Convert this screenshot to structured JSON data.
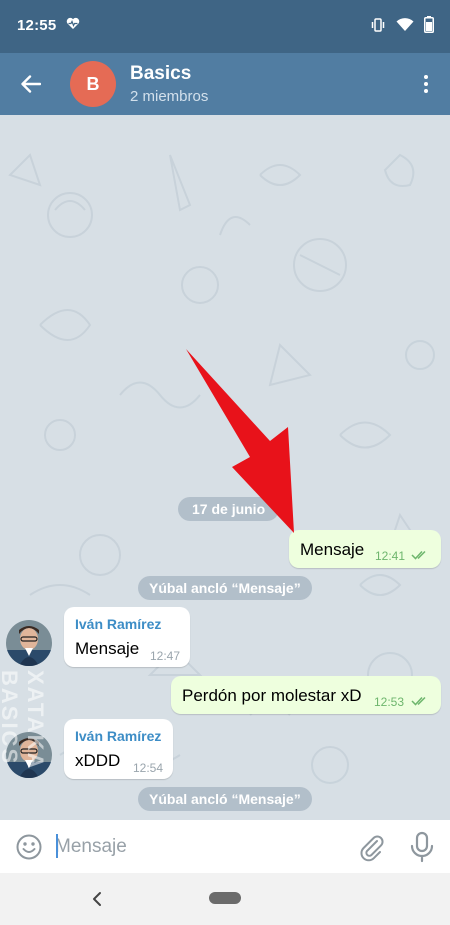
{
  "status_bar": {
    "time": "12:55",
    "left_icon": "heart-pulse-icon",
    "right_icons": [
      "vibrate-icon",
      "wifi-icon",
      "battery-icon"
    ]
  },
  "header": {
    "avatar_letter": "B",
    "avatar_color": "#e56b55",
    "title": "Basics",
    "subtitle": "2 miembros",
    "background": "#517da2"
  },
  "chat": {
    "date_separator": "17 de junio",
    "items": [
      {
        "type": "outgoing",
        "text": "Mensaje",
        "time": "12:41",
        "read": true
      },
      {
        "type": "service",
        "text": "Yúbal ancló “Mensaje”"
      },
      {
        "type": "incoming",
        "sender": "Iván Ramírez",
        "text": "Mensaje",
        "time": "12:47"
      },
      {
        "type": "outgoing",
        "text": "Perdón por molestar xD",
        "time": "12:53",
        "read": true
      },
      {
        "type": "incoming",
        "sender": "Iván Ramírez",
        "text": "xDDD",
        "time": "12:54"
      },
      {
        "type": "service",
        "text": "Yúbal ancló “Mensaje”"
      }
    ],
    "watermark": "XATAKA BASICS"
  },
  "input_bar": {
    "placeholder": "Mensaje",
    "emoji_icon": "emoji-icon",
    "attach_icon": "paperclip-icon",
    "mic_icon": "microphone-icon"
  },
  "nav_bar": {
    "back_icon": "nav-back-icon",
    "home_icon": "home-pill-icon"
  },
  "colors": {
    "accent": "#517da2",
    "status_bar": "#3f6585",
    "outgoing_bubble": "#eeffde",
    "sender_name": "#3d8dc6",
    "annotation_arrow": "#e8121a"
  }
}
